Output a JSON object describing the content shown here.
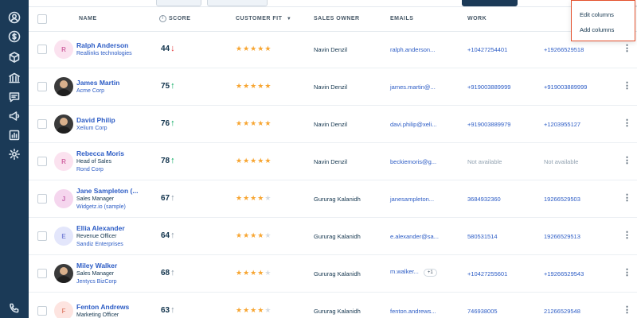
{
  "sidebar": {
    "icons": [
      "contacts-icon",
      "deals-icon",
      "products-icon",
      "accounts-icon",
      "chat-icon",
      "campaigns-icon",
      "reports-icon",
      "settings-icon",
      "phone-icon"
    ]
  },
  "table": {
    "headers": {
      "name": "NAME",
      "score": "SCORE",
      "customer_fit": "CUSTOMER FIT",
      "sales_owner": "SALES OWNER",
      "emails": "EMAILS",
      "work": "WORK"
    },
    "rows": [
      {
        "initial": "R",
        "avatar_type": "initial",
        "avatar_bg": "#fbe2ef",
        "avatar_fg": "#d36aa5",
        "name": "Ralph Anderson",
        "title": "",
        "company": "Reallinks technologies",
        "score": "44",
        "trend": "down",
        "rating": 5,
        "owner": "Navin Denzil",
        "email": "ralph.anderson...",
        "email_extra": "",
        "work": "+10427254401",
        "mobile": "+19266529518"
      },
      {
        "initial": "",
        "avatar_type": "photo",
        "avatar_bg": "",
        "avatar_fg": "",
        "name": "James Martin",
        "title": "",
        "company": "Acme Corp",
        "score": "75",
        "trend": "up",
        "rating": 5,
        "owner": "Navin Denzil",
        "email": "james.martin@...",
        "email_extra": "",
        "work": "+919003889999",
        "mobile": "+919003889999"
      },
      {
        "initial": "",
        "avatar_type": "photo",
        "avatar_bg": "",
        "avatar_fg": "",
        "name": "David Philip",
        "title": "",
        "company": "Xelium Corp",
        "score": "76",
        "trend": "up",
        "rating": 5,
        "owner": "Navin Denzil",
        "email": "davi.philip@xeli...",
        "email_extra": "",
        "work": "+919003889979",
        "mobile": "+1203955127"
      },
      {
        "initial": "R",
        "avatar_type": "initial",
        "avatar_bg": "#fbe2ef",
        "avatar_fg": "#d36aa5",
        "name": "Rebecca Moris",
        "title": "Head of Sales",
        "company": "Rond Corp",
        "score": "78",
        "trend": "up",
        "rating": 5,
        "owner": "Navin Denzil",
        "email": "beckiemoris@g...",
        "email_extra": "",
        "work": "Not available",
        "mobile": "Not available"
      },
      {
        "initial": "J",
        "avatar_type": "initial",
        "avatar_bg": "#f5d6ee",
        "avatar_fg": "#c765ad",
        "name": "Jane Sampleton (...",
        "title": "Sales Manager",
        "company": "Widgetz.io (sample)",
        "score": "67",
        "trend": "flat",
        "rating": 4,
        "owner": "Gururag Kalanidh",
        "email": "janesampleton...",
        "email_extra": "",
        "work": "3684932360",
        "mobile": "19266529503"
      },
      {
        "initial": "E",
        "avatar_type": "initial",
        "avatar_bg": "#e3e6fb",
        "avatar_fg": "#7f88d9",
        "name": "Ellia Alexander",
        "title": "Revenue Officer",
        "company": "Sandiz Enterprises",
        "score": "64",
        "trend": "flat",
        "rating": 4,
        "owner": "Gururag Kalanidh",
        "email": "e.alexander@sa...",
        "email_extra": "",
        "work": "580531514",
        "mobile": "19266529513"
      },
      {
        "initial": "",
        "avatar_type": "photo",
        "avatar_bg": "",
        "avatar_fg": "",
        "name": "Miley Walker",
        "title": "Sales Manager",
        "company": "Jentycs BizCorp",
        "score": "68",
        "trend": "flat",
        "rating": 4,
        "owner": "Gururag Kalanidh",
        "email": "m.walker...",
        "email_extra": "+1",
        "work": "+10427255601",
        "mobile": "+19266529543"
      },
      {
        "initial": "F",
        "avatar_type": "initial",
        "avatar_bg": "#fde4e0",
        "avatar_fg": "#e38a78",
        "name": "Fenton Andrews",
        "title": "Marketing Officer",
        "company": "",
        "score": "63",
        "trend": "flat",
        "rating": 4,
        "owner": "Gururag Kalanidh",
        "email": "fenton.andrews...",
        "email_extra": "",
        "work": "746938005",
        "mobile": "21266529548"
      }
    ]
  },
  "dropdown": {
    "items": [
      "Edit columns",
      "Add columns"
    ]
  },
  "colors": {
    "star": "#f7a531",
    "star_empty": "#d4dbe2",
    "trend_up": "#00a85a",
    "trend_down": "#e43538",
    "trend_flat": "#8897a5",
    "sidebar": "#1b3a57",
    "highlight": "#e4502d"
  }
}
